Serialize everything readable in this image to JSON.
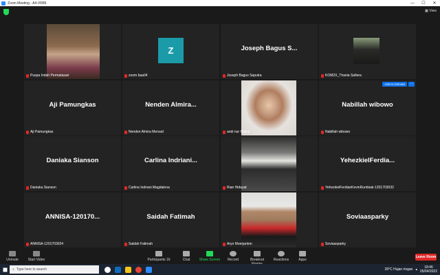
{
  "window": {
    "title": "Zoom Meeting - A4-VR86",
    "minimize": "—",
    "maximize": "☐",
    "close": "✕"
  },
  "top": {
    "view_label": "▦ View"
  },
  "tiles": [
    {
      "name": "Puspa Indah Permatasari",
      "type": "video"
    },
    {
      "name": "zoom baa04",
      "type": "avatar",
      "avatar_letter": "Z"
    },
    {
      "name": "Joseph Bagus Saputra",
      "big": "Joseph Bagus S..."
    },
    {
      "name": "KOM2X_Thania Safiera",
      "type": "video"
    },
    {
      "name": "Aji Pamungkas",
      "big": "Aji Pamungkas"
    },
    {
      "name": "Nenden Almira Mersad",
      "big": "Nenden Almira..."
    },
    {
      "name": "andi nur Halisa",
      "type": "video"
    },
    {
      "name": "Nabillah wibowo",
      "big": "Nabillah wibowo",
      "ask_unmute": "Ask to Unmute",
      "more": "···"
    },
    {
      "name": "Daniaka Sianson",
      "big": "Daniaka Sianson"
    },
    {
      "name": "Carlina Indriani Magdalena",
      "big": "Carlina Indriani..."
    },
    {
      "name": "Rian Hidayat",
      "type": "video"
    },
    {
      "name": "YehezkielFerdianKevinRumbiak-1201703032",
      "big": "YehezkielFerdia..."
    },
    {
      "name": "ANNISA-1201703024",
      "big": "ANNISA-120170..."
    },
    {
      "name": "Saidah Fatimah",
      "big": "Saidah Fatimah"
    },
    {
      "name": "Aryo Moerjanton",
      "type": "video"
    },
    {
      "name": "Soviaasparky",
      "big": "Soviaasparky"
    }
  ],
  "toolbar": {
    "unmute": "Unmute",
    "start_video": "Start Video",
    "participants": "Participants",
    "participants_count": "16",
    "chat": "Chat",
    "share_screen": "Share Screen",
    "record": "Record",
    "breakout": "Breakout Rooms",
    "reactions": "Reactions",
    "apps": "Apps",
    "leave": "Leave Room"
  },
  "taskbar": {
    "search_placeholder": "Type here to search",
    "weather": "28°C  Hujan ringan",
    "time": "18:46",
    "date": "05/04/2022"
  },
  "colors": {
    "accent": "#0e72ed",
    "leave": "#e02828",
    "share": "#23d959",
    "tile_bg": "#232323"
  }
}
